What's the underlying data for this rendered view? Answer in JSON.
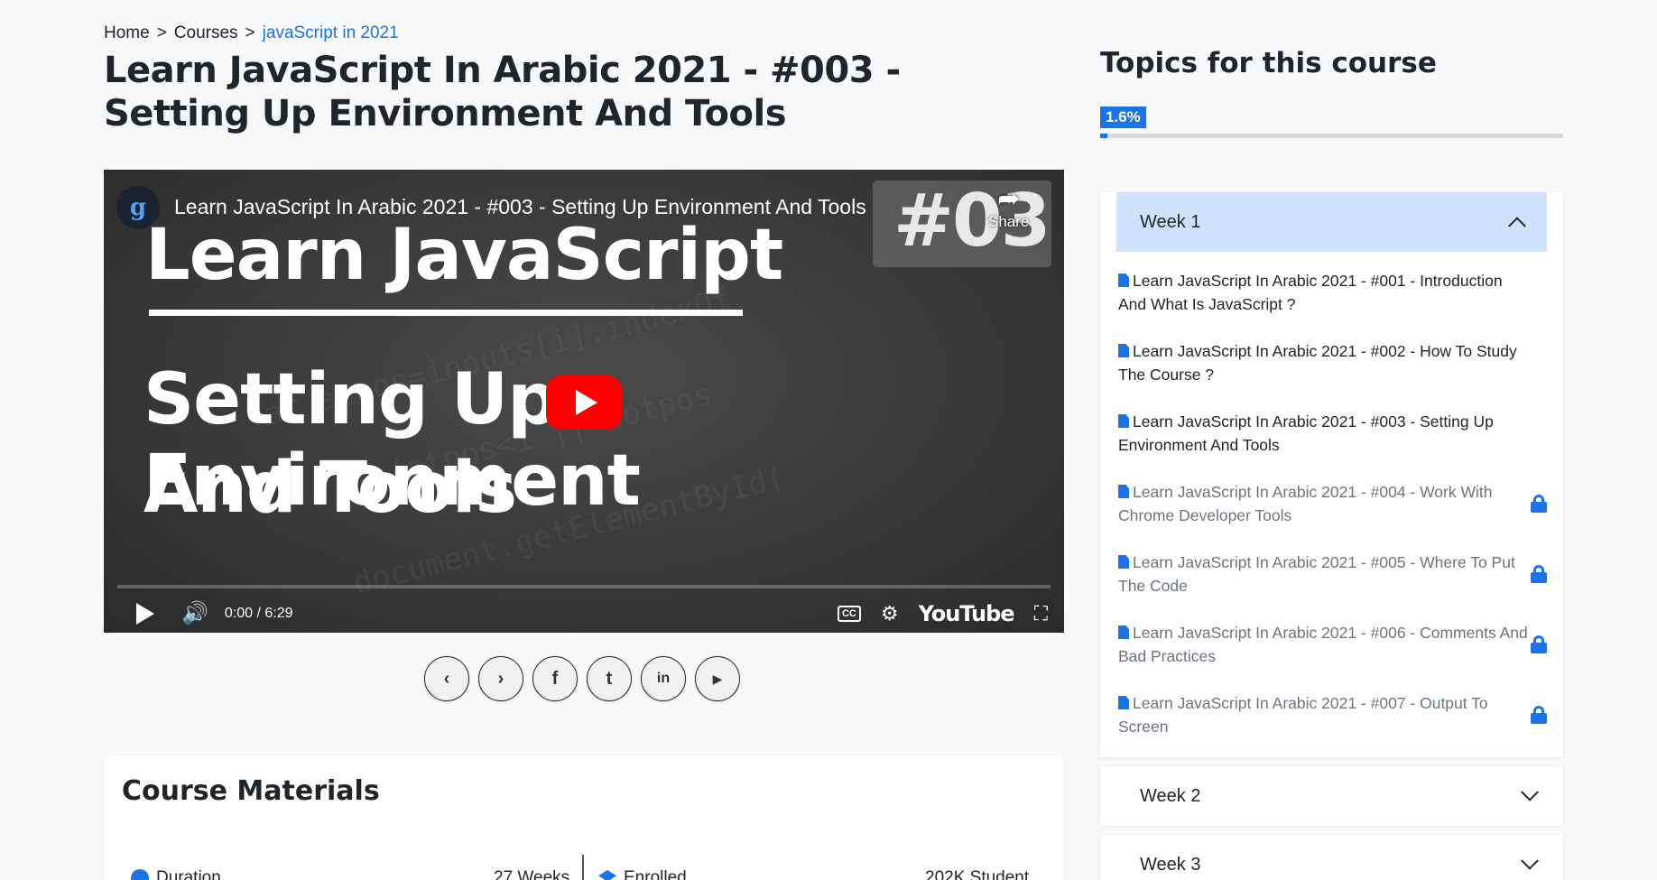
{
  "breadcrumb": {
    "home": "Home",
    "sep1": ">",
    "courses": "Courses",
    "sep2": ">",
    "current": "javaScript in 2021"
  },
  "page_title": "Learn JavaScript In Arabic 2021 - #003 - Setting Up Environment And Tools",
  "video": {
    "channel_logo": "g",
    "yt_title": "Learn JavaScript In Arabic 2021 - #003 - Setting Up Environment And Tools",
    "thumb_number": "#03",
    "share_label": "Share",
    "thumb_line1": "Learn JavaScript",
    "thumb_line2": "Setting Up Environment",
    "thumb_line3": "And Tools",
    "time": "0:00 / 6:29",
    "cc_label": "CC",
    "youtube_label": "YouTube"
  },
  "share_buttons": [
    {
      "name": "prev-icon",
      "glyph": "‹"
    },
    {
      "name": "next-icon",
      "glyph": "›"
    },
    {
      "name": "facebook-icon",
      "glyph": "f"
    },
    {
      "name": "twitter-icon",
      "glyph": "🐦"
    },
    {
      "name": "linkedin-icon",
      "glyph": "in"
    },
    {
      "name": "youtube-icon",
      "glyph": "▶"
    }
  ],
  "materials": {
    "title": "Course Materials",
    "duration_label": "Duration",
    "duration_value": "27 Weeks",
    "enrolled_label": "Enrolled",
    "enrolled_value": "202K Student"
  },
  "sidebar": {
    "title": "Topics for this course",
    "progress_label": "1.6%",
    "progress_fraction": 0.016,
    "weeks": [
      {
        "label": "Week 1",
        "open": true,
        "lessons": [
          {
            "title": "Learn JavaScript In Arabic 2021 - #001 - Introduction And What Is JavaScript ?",
            "locked": false
          },
          {
            "title": "Learn JavaScript In Arabic 2021 - #002 - How To Study The Course ?",
            "locked": false
          },
          {
            "title": "Learn JavaScript In Arabic 2021 - #003 - Setting Up Environment And Tools",
            "locked": false
          },
          {
            "title": "Learn JavaScript In Arabic 2021 - #004 - Work With Chrome Developer Tools",
            "locked": true
          },
          {
            "title": "Learn JavaScript In Arabic 2021 - #005 - Where To Put The Code",
            "locked": true
          },
          {
            "title": "Learn JavaScript In Arabic 2021 - #006 - Comments And Bad Practices",
            "locked": true
          },
          {
            "title": "Learn JavaScript In Arabic 2021 - #007 - Output To Screen",
            "locked": true
          }
        ]
      },
      {
        "label": "Week 2",
        "open": false,
        "lessons": []
      },
      {
        "label": "Week 3",
        "open": false,
        "lessons": []
      }
    ]
  },
  "colors": {
    "accent": "#1a73e8",
    "open_week_bg": "#cfe2fc",
    "yt_red": "#ff0000"
  }
}
